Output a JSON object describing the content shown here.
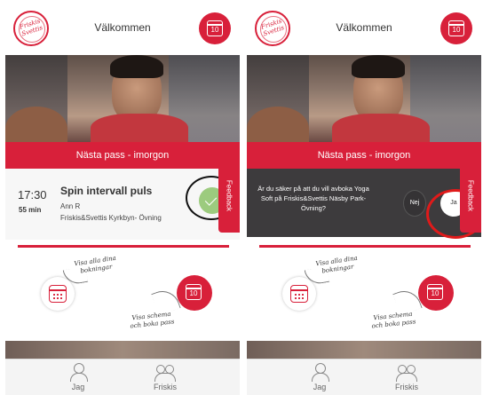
{
  "brand": {
    "logo_text": "Friskis Svettis",
    "accent": "#d8203a"
  },
  "colors": {
    "accent": "#d8203a",
    "confirm_green": "#9ccb7e",
    "dialog_bg": "#3d3b3d"
  },
  "screens": [
    {
      "header": {
        "title": "Välkommen",
        "calendar_number": "10"
      },
      "next_label": "Nästa pass - imorgon",
      "feedback_label": "Feedback",
      "booking": {
        "time": "17:30",
        "duration": "55 min",
        "class_name": "Spin intervall puls",
        "instructor": "Ann R",
        "location": "Friskis&Svettis Kyrkbyn- Övning"
      },
      "tips": {
        "bookings": "Visa alla dina\nbokningar",
        "schedule": "Visa schema\noch boka pass",
        "calendar_number": "10"
      },
      "tabs": [
        {
          "label": "Jag",
          "icon": "person-icon"
        },
        {
          "label": "Friskis",
          "icon": "group-icon"
        }
      ]
    },
    {
      "header": {
        "title": "Välkommen",
        "calendar_number": "10"
      },
      "next_label": "Nästa pass - imorgon",
      "feedback_label": "Feedback",
      "dialog": {
        "question": "Är du säker på att du vill avboka Yoga Soft på Friskis&Svettis Näsby Park-Övning?",
        "no_label": "Nej",
        "yes_label": "Ja"
      },
      "tips": {
        "bookings": "Visa alla dina\nbokningar",
        "schedule": "Visa schema\noch boka pass",
        "calendar_number": "10"
      },
      "tabs": [
        {
          "label": "Jag",
          "icon": "person-icon"
        },
        {
          "label": "Friskis",
          "icon": "group-icon"
        }
      ]
    }
  ]
}
